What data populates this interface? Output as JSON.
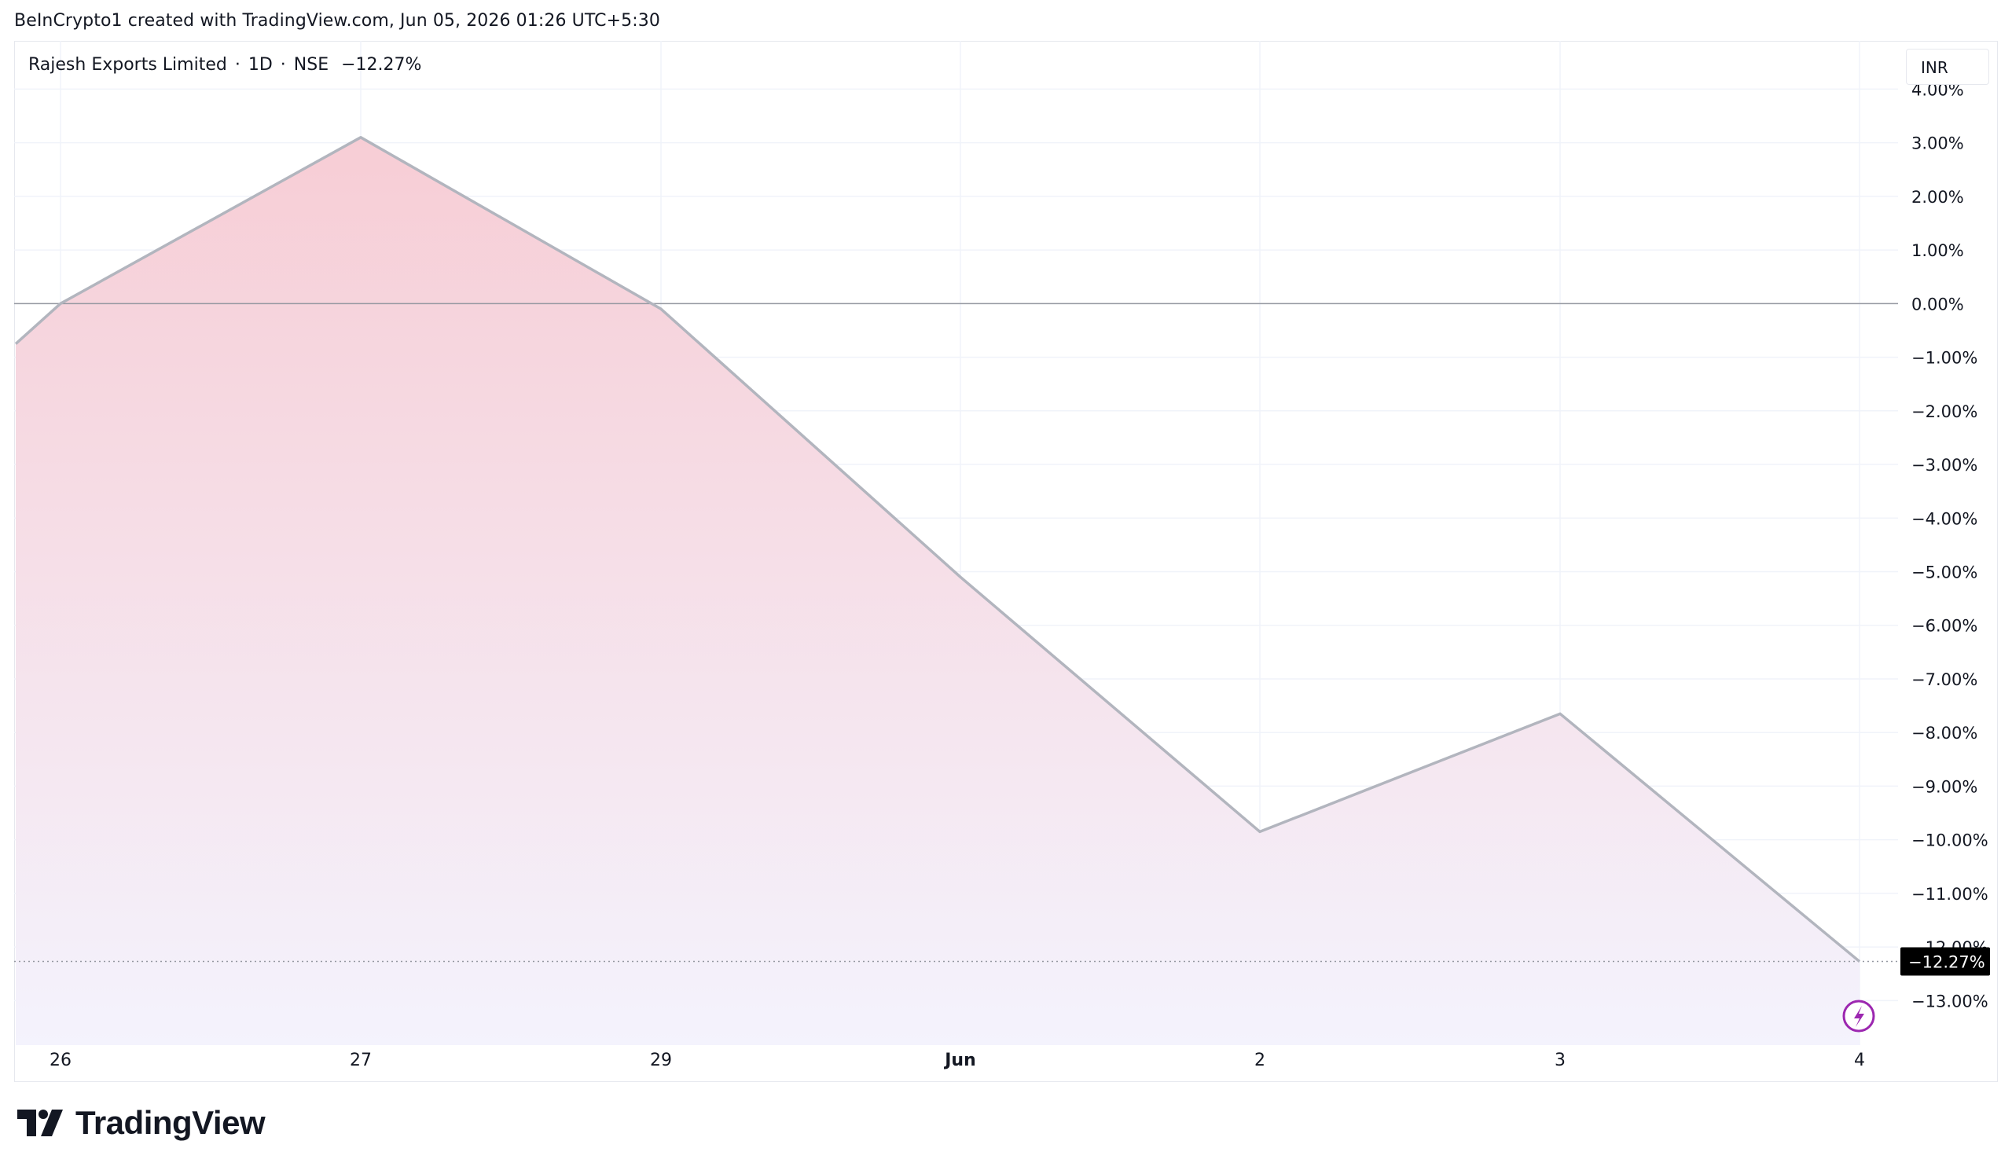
{
  "attribution": "BeInCrypto1 created with TradingView.com, Jun 05, 2026 01:26 UTC+5:30",
  "legend": {
    "symbol": "Rajesh Exports Limited",
    "interval": "1D",
    "exchange": "NSE",
    "change": "−12.27%",
    "separator": "·"
  },
  "currency": "INR",
  "logo_text": "TradingView",
  "colors": {
    "line": "#b2b5be",
    "gradient_top": "#f7cdd5",
    "gradient_bottom": "#f4f3fd",
    "zero_line": "#9598a1",
    "grid": "#f0f3fa",
    "label_bg": "#000000",
    "label_text": "#ffffff",
    "flash_icon": "#9c27b0"
  },
  "chart_data": {
    "type": "area",
    "x_tick_labels": [
      "26",
      "27",
      "29",
      "Jun",
      "2",
      "3",
      "4"
    ],
    "x_tick_bold": [
      "Jun"
    ],
    "points": [
      {
        "x": "25",
        "y": -0.75
      },
      {
        "x": "26",
        "y": 0.0
      },
      {
        "x": "27",
        "y": 3.1
      },
      {
        "x": "29",
        "y": -0.1
      },
      {
        "x": "Jun",
        "y": -5.1
      },
      {
        "x": "2",
        "y": -9.85
      },
      {
        "x": "3",
        "y": -7.65
      },
      {
        "x": "4",
        "y": -12.27
      }
    ],
    "y_ticks": [
      4,
      3,
      2,
      1,
      0,
      -1,
      -2,
      -3,
      -4,
      -5,
      -6,
      -7,
      -8,
      -9,
      -10,
      -11,
      -12,
      -13
    ],
    "y_tick_labels": [
      "4.00%",
      "3.00%",
      "2.00%",
      "1.00%",
      "0.00%",
      "−1.00%",
      "−2.00%",
      "−3.00%",
      "−4.00%",
      "−5.00%",
      "−6.00%",
      "−7.00%",
      "−8.00%",
      "−9.00%",
      "−10.00%",
      "−11.00%",
      "−12.00%",
      "−13.00%"
    ],
    "ylim": [
      -13.83,
      4.9
    ],
    "baseline": 0,
    "last_value": -12.27,
    "last_value_label": "−12.27%",
    "grid": true
  }
}
